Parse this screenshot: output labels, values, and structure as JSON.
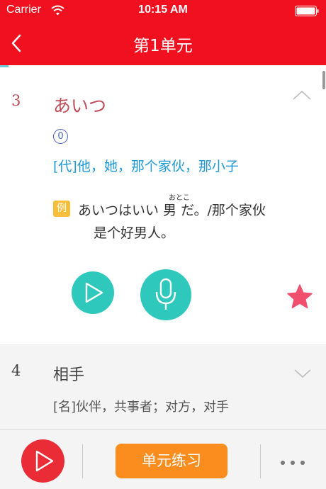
{
  "status_bar": {
    "carrier": "Carrier",
    "time": "10:15 AM"
  },
  "nav": {
    "title": "第1单元"
  },
  "words": [
    {
      "number": "3",
      "word": "あいつ",
      "accent": "0",
      "meaning": "[代]他，她，那个家伙，那小子",
      "example_label": "例",
      "example_ruby": "おとこ",
      "example_line1": "あいつはいい 男 だ。/那个家伙",
      "example_line2": "是个好男人。"
    },
    {
      "number": "4",
      "word": "相手",
      "meaning": "[名]伙伴，共事者；对方，对手"
    }
  ],
  "toolbar": {
    "practice_label": "单元练习"
  },
  "icons": {
    "wifi": "wifi-icon",
    "battery": "battery-icon",
    "back": "chevron-left-icon",
    "collapse": "chevron-up-icon",
    "expand": "chevron-down-icon",
    "play": "play-icon",
    "record": "microphone-icon",
    "favorite": "star-icon",
    "more": "more-icon"
  },
  "colors": {
    "brand_red": "#f0101f",
    "teal": "#2ec8bd",
    "word_red": "#c04d5a",
    "meaning_blue": "#1f9ad6",
    "example_badge": "#f6be3b",
    "star_pink": "#f0506e",
    "practice_orange": "#fb8d1e",
    "play_red": "#e92c36"
  }
}
